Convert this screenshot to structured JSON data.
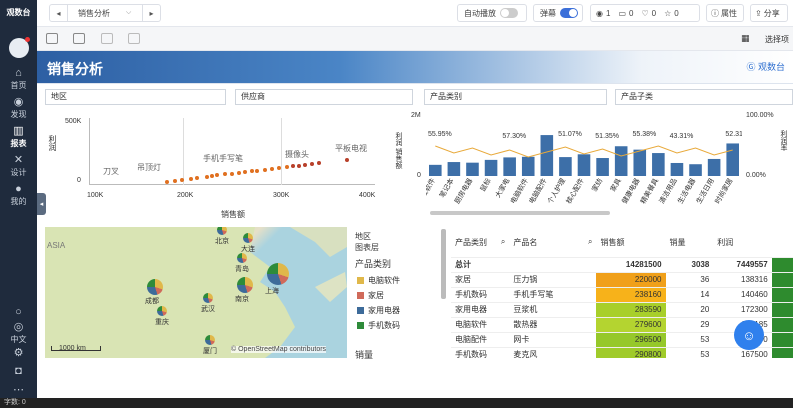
{
  "app": {
    "logo_text": "观数台"
  },
  "sidebar": {
    "items": [
      {
        "label": "首页",
        "icon": "home-icon"
      },
      {
        "label": "发现",
        "icon": "compass-icon"
      },
      {
        "label": "报表",
        "icon": "chart-icon"
      },
      {
        "label": "设计",
        "icon": "tools-icon"
      },
      {
        "label": "我的",
        "icon": "user-icon"
      }
    ],
    "bottom": [
      {
        "label": "",
        "icon": "bulb-icon"
      },
      {
        "label": "中文",
        "icon": "globe-icon"
      },
      {
        "label": "",
        "icon": "settings-icon"
      },
      {
        "label": "",
        "icon": "robot-icon"
      },
      {
        "label": "",
        "icon": "more-icon"
      }
    ]
  },
  "topbar": {
    "report_name": "销售分析",
    "autoplay_label": "自动播放",
    "barrage_label": "弹幕",
    "views": "1",
    "comments": "0",
    "likes": "0",
    "stars": "0",
    "properties_label": "属性",
    "share_label": "分享"
  },
  "toolbar": {
    "select_label": "选择项"
  },
  "header": {
    "title": "销售分析",
    "logo_text": "观数台"
  },
  "filters": [
    "地区",
    "供应商",
    "产品类别",
    "产品子类"
  ],
  "scatter": {
    "ylabel": "利润",
    "xlabel": "销售额",
    "y_ticks": [
      "500K",
      "0"
    ],
    "x_ticks": [
      "100K",
      "200K",
      "300K",
      "400K"
    ],
    "annotations": [
      "刀叉",
      "吊顶灯",
      "手机手写笔",
      "摄像头",
      "平板电视"
    ]
  },
  "combo": {
    "ylabel_left": "利润 销售额",
    "ylabel_right": "利润率",
    "left_ticks": [
      "2M",
      "0"
    ],
    "right_ticks": [
      "100.00%",
      "0.00%"
    ],
    "categories": [
      "办公软件",
      "笔记本",
      "厨房电器",
      "鼠标",
      "大家电",
      "电脑软件",
      "电脑配件",
      "个人护理",
      "核心配件",
      "家纺",
      "家具",
      "健康电器",
      "精美餐具",
      "清洁用品",
      "生活电器",
      "生活日用",
      "时尚家居"
    ],
    "pct_labels": [
      "55.95%",
      "57.30%",
      "51.07%",
      "51.35%",
      "55.38%",
      "43.31%",
      "52.31%"
    ]
  },
  "chart_data": {
    "type": "bar",
    "categories": [
      "办公软件",
      "笔记本",
      "厨房电器",
      "鼠标",
      "大家电",
      "电脑软件",
      "电脑配件",
      "个人护理",
      "核心配件",
      "家纺",
      "家具",
      "健康电器",
      "精美餐具",
      "清洁用品",
      "生活电器",
      "生活日用",
      "时尚家居"
    ],
    "series": [
      {
        "values": [
          0.36,
          0.45,
          0.43,
          0.52,
          0.6,
          0.62,
          1.32,
          0.61,
          0.7,
          0.58,
          0.96,
          0.85,
          0.74,
          0.42,
          0.38,
          0.55,
          1.05
        ]
      }
    ],
    "ylim": [
      0,
      2
    ]
  },
  "map": {
    "cities": [
      "北京",
      "大连",
      "青岛",
      "成都",
      "重庆",
      "武汉",
      "南京",
      "上海",
      "厦门"
    ],
    "scale": "1000 km",
    "attribution": "© OpenStreetMap contributors",
    "left_label": "ASIA"
  },
  "map_legend": {
    "header1": "地区",
    "header2": "图表层",
    "section_title": "产品类别",
    "items": [
      {
        "label": "电脑软件",
        "color": "#e0b84a"
      },
      {
        "label": "家居",
        "color": "#d06a5a"
      },
      {
        "label": "家用电器",
        "color": "#3d6b9a"
      },
      {
        "label": "手机数码",
        "color": "#2e8b3a"
      }
    ],
    "footer": "销量"
  },
  "table": {
    "headers": [
      "产品类别",
      "产品名",
      "销售额",
      "销量",
      "利润"
    ],
    "total": {
      "label": "总计",
      "sales": "14281500",
      "qty": "3038",
      "profit": "7449557"
    },
    "rows": [
      {
        "cat": "家居",
        "name": "压力锅",
        "sales": "220000",
        "qty": "36",
        "profit": "138316",
        "color": "#f0a01a"
      },
      {
        "cat": "手机数码",
        "name": "手机手写笔",
        "sales": "238160",
        "qty": "14",
        "profit": "140460",
        "color": "#f7b21a"
      },
      {
        "cat": "家用电器",
        "name": "豆浆机",
        "sales": "283590",
        "qty": "20",
        "profit": "172300",
        "color": "#a8cf2a"
      },
      {
        "cat": "电脑软件",
        "name": "散热器",
        "sales": "279600",
        "qty": "29",
        "profit": "160185",
        "color": "#b4d430"
      },
      {
        "cat": "电脑配件",
        "name": "网卡",
        "sales": "296500",
        "qty": "53",
        "profit": "172500",
        "color": "#96c82a"
      },
      {
        "cat": "手机数码",
        "name": "麦克风",
        "sales": "290800",
        "qty": "53",
        "profit": "167500",
        "color": "#a0cb2a"
      }
    ]
  },
  "statusbar": {
    "text": "字数: 0"
  }
}
